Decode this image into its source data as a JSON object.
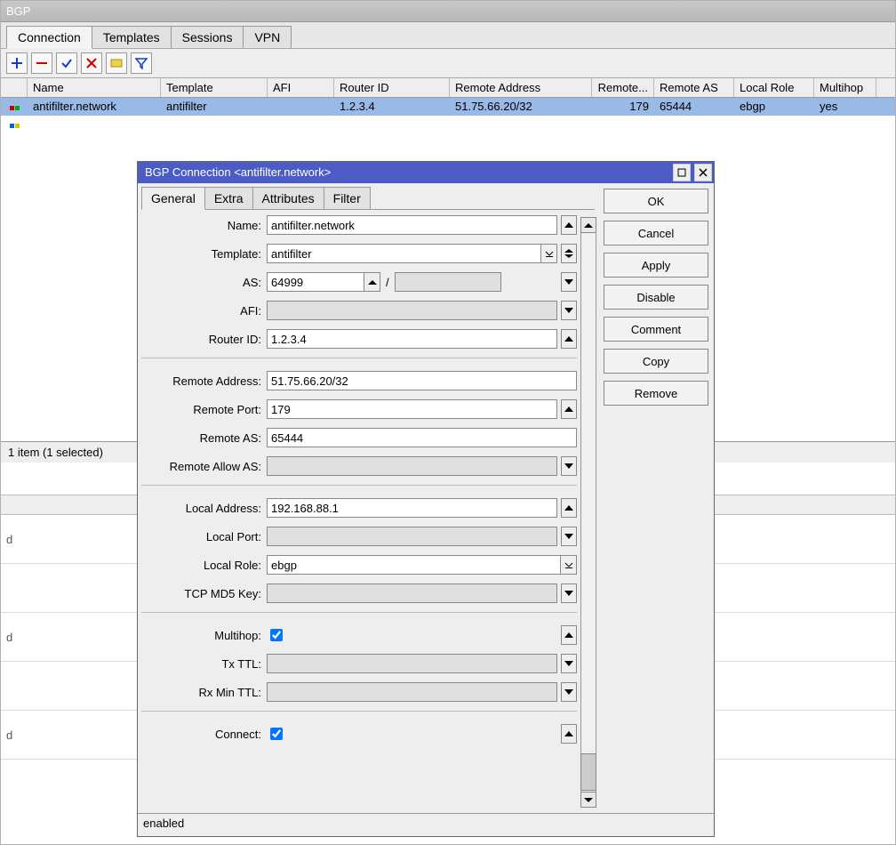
{
  "window": {
    "title": "BGP"
  },
  "tabs": [
    "Connection",
    "Templates",
    "Sessions",
    "VPN"
  ],
  "active_tab": 0,
  "columns": [
    "Name",
    "Template",
    "AFI",
    "Router ID",
    "Remote Address",
    "Remote...",
    "Remote AS",
    "Local Role",
    "Multihop"
  ],
  "row": {
    "name": "antifilter.network",
    "template": "antifilter",
    "afi": "",
    "router_id": "1.2.3.4",
    "remote_addr": "51.75.66.20/32",
    "remote_port": "179",
    "remote_as": "65444",
    "local_role": "ebgp",
    "multihop": "yes"
  },
  "status": "1 item (1 selected)",
  "bg_col_label": "d",
  "dialog": {
    "title": "BGP Connection <antifilter.network>",
    "tabs": [
      "General",
      "Extra",
      "Attributes",
      "Filter"
    ],
    "active_tab": 0,
    "buttons": [
      "OK",
      "Cancel",
      "Apply",
      "Disable",
      "Comment",
      "Copy",
      "Remove"
    ],
    "status": "enabled",
    "fields": {
      "name_label": "Name:",
      "name": "antifilter.network",
      "template_label": "Template:",
      "template": "antifilter",
      "as_label": "AS:",
      "as": "64999",
      "as2": "",
      "afi_label": "AFI:",
      "afi": "",
      "routerid_label": "Router ID:",
      "routerid": "1.2.3.4",
      "raddr_label": "Remote Address:",
      "raddr": "51.75.66.20/32",
      "rport_label": "Remote Port:",
      "rport": "179",
      "ras_label": "Remote AS:",
      "ras": "65444",
      "rallow_label": "Remote Allow AS:",
      "rallow": "",
      "laddr_label": "Local Address:",
      "laddr": "192.168.88.1",
      "lport_label": "Local Port:",
      "lport": "",
      "lrole_label": "Local Role:",
      "lrole": "ebgp",
      "md5_label": "TCP MD5 Key:",
      "md5": "",
      "multihop_label": "Multihop:",
      "txttl_label": "Tx TTL:",
      "txttl": "",
      "rxttl_label": "Rx Min TTL:",
      "rxttl": "",
      "connect_label": "Connect:"
    }
  }
}
